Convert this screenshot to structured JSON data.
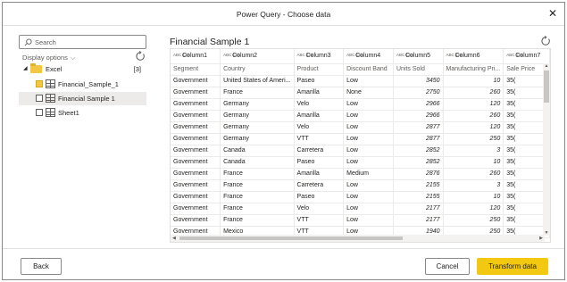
{
  "window": {
    "title": "Power Query - Choose data",
    "close_glyph": "✕"
  },
  "sidebar": {
    "search_placeholder": "Search",
    "display_options_label": "Display options",
    "tree": [
      {
        "label": "Excel",
        "count": "[3]",
        "type": "folder",
        "expanded": true
      },
      {
        "label": "Financial_Sample_1",
        "type": "table",
        "checked": true,
        "selected": false
      },
      {
        "label": "Financial Sample 1",
        "type": "table",
        "checked": false,
        "selected": true
      },
      {
        "label": "Sheet1",
        "type": "table",
        "checked": false,
        "selected": false
      }
    ]
  },
  "preview": {
    "title": "Financial Sample 1",
    "columns": [
      {
        "type": "ABC 123",
        "name": "Column1"
      },
      {
        "type": "ABC 123",
        "name": "Column2"
      },
      {
        "type": "ABC 123",
        "name": "Column3"
      },
      {
        "type": "ABC 123",
        "name": "Column4"
      },
      {
        "type": "ABC 123",
        "name": "Column5"
      },
      {
        "type": "ABC 123",
        "name": "Column6"
      },
      {
        "type": "ABC 123",
        "name": "Column7"
      }
    ],
    "header_row": [
      "Segment",
      "Country",
      "Product",
      "Discount Band",
      "Units Sold",
      "Manufacturing Pri...",
      "Sale Price"
    ],
    "rows": [
      [
        "Government",
        "United States of Ameri...",
        "Paseo",
        "Low",
        "3450",
        "10",
        "35("
      ],
      [
        "Government",
        "France",
        "Amarilla",
        "None",
        "2750",
        "260",
        "35("
      ],
      [
        "Government",
        "Germany",
        "Velo",
        "Low",
        "2966",
        "120",
        "35("
      ],
      [
        "Government",
        "Germany",
        "Amarilla",
        "Low",
        "2966",
        "260",
        "35("
      ],
      [
        "Government",
        "Germany",
        "Velo",
        "Low",
        "2877",
        "120",
        "35("
      ],
      [
        "Government",
        "Germany",
        "VTT",
        "Low",
        "2877",
        "250",
        "35("
      ],
      [
        "Government",
        "Canada",
        "Carretera",
        "Low",
        "2852",
        "3",
        "35("
      ],
      [
        "Government",
        "Canada",
        "Paseo",
        "Low",
        "2852",
        "10",
        "35("
      ],
      [
        "Government",
        "France",
        "Amarilla",
        "Medium",
        "2876",
        "260",
        "35("
      ],
      [
        "Government",
        "France",
        "Carretera",
        "Low",
        "2155",
        "3",
        "35("
      ],
      [
        "Government",
        "France",
        "Paseo",
        "Low",
        "2155",
        "10",
        "35("
      ],
      [
        "Government",
        "France",
        "Velo",
        "Low",
        "2177",
        "120",
        "35("
      ],
      [
        "Government",
        "France",
        "VTT",
        "Low",
        "2177",
        "250",
        "35("
      ],
      [
        "Government",
        "Mexico",
        "VTT",
        "Low",
        "1940",
        "250",
        "35("
      ]
    ]
  },
  "footer": {
    "back_label": "Back",
    "cancel_label": "Cancel",
    "transform_label": "Transform data"
  },
  "colors": {
    "accent": "#f2c811",
    "folder": "#f2c744",
    "selected_row": "#edebe9"
  },
  "icons": [
    "search-icon",
    "refresh-icon",
    "chevron-down-icon",
    "folder-icon",
    "table-icon",
    "close-icon"
  ]
}
